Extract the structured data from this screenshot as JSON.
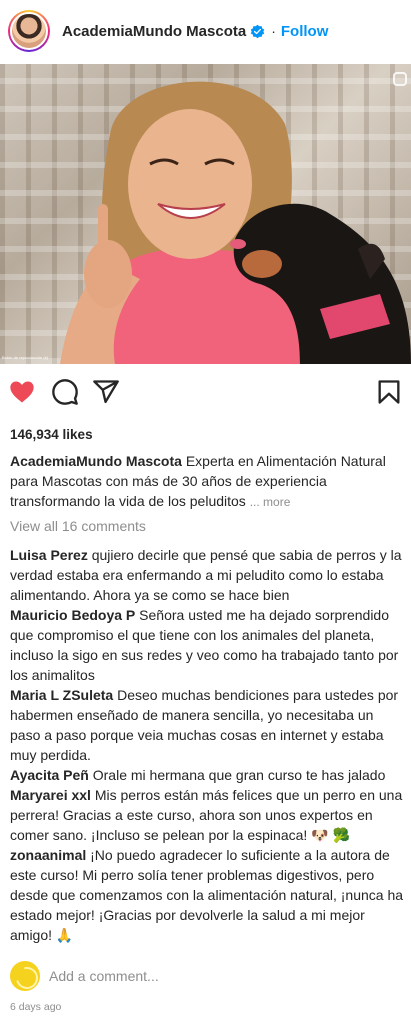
{
  "header": {
    "username": "AcademiaMundo Mascota",
    "separator": "·",
    "follow_label": "Follow",
    "verified_icon": "verified-badge-icon"
  },
  "photo": {
    "caption_tiny": "Botón de reproducción (k)"
  },
  "actions": {
    "like_icon": "heart-filled-icon",
    "comment_icon": "comment-bubble-icon",
    "share_icon": "paper-plane-icon",
    "save_icon": "bookmark-icon",
    "like_color": "#ed4956"
  },
  "likes_text": "146,934 likes",
  "caption": {
    "username": "AcademiaMundo Mascota",
    "text": "Experta en Alimentación Natural para Mascotas con más de 30 años de experiencia transformando la vida de los peluditos",
    "more_label": "... more"
  },
  "view_all": "View all 16 comments",
  "comments": [
    {
      "user": "Luisa Perez",
      "text": "qujiero decirle que pensé que sabia de perros y la verdad estaba era enfermando a mi peludito como lo estaba alimentando. Ahora ya se como se hace bien"
    },
    {
      "user": "Mauricio Bedoya P",
      "text": "Señora usted me ha dejado sorprendido que compromiso el que tiene con los animales del planeta, incluso la sigo en sus redes y veo como ha trabajado tanto por los animalitos"
    },
    {
      "user": "Maria L ZSuleta",
      "text": "Deseo muchas bendiciones para ustedes por habermen enseñado de manera sencilla, yo necesitaba un paso a paso porque veia muchas cosas en internet y estaba muy perdida."
    },
    {
      "user": "Ayacita Peñ",
      "text": "Orale mi hermana que gran curso te has jalado"
    },
    {
      "user": "Maryarei xxl",
      "text": "Mis perros están más felices que un perro en una perrera! Gracias a este curso, ahora son unos expertos en comer sano. ¡Incluso se pelean por la espinaca! 🐶 🥦"
    },
    {
      "user": "zonaanimal",
      "text": "¡No puedo agradecer lo suficiente a la autora de este curso! Mi perro solía tener problemas digestivos, pero desde que comenzamos con la alimentación natural, ¡nunca ha estado mejor! ¡Gracias por devolverle la salud a mi mejor amigo! 🙏"
    }
  ],
  "add_comment": {
    "placeholder": "Add a comment..."
  },
  "time_ago": "6 days ago"
}
